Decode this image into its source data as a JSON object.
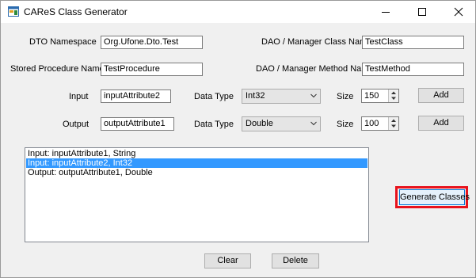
{
  "window": {
    "title": "CAReS Class Generator"
  },
  "labels": {
    "dto_namespace": "DTO Namespace",
    "stored_procedure": "Stored Procedure Name",
    "dao_class": "DAO /  Manager Class Name",
    "dao_method": "DAO /  Manager Method Name",
    "input": "Input",
    "output": "Output",
    "data_type": "Data Type",
    "size": "Size"
  },
  "fields": {
    "dto_namespace": "Org.Ufone.Dto.Test",
    "stored_procedure": "TestProcedure",
    "dao_class": "TestClass",
    "dao_method": "TestMethod",
    "input_attr": "inputAttribute2",
    "output_attr": "outputAttribute1",
    "input_type": "Int32",
    "output_type": "Double",
    "input_size": "150",
    "output_size": "100"
  },
  "buttons": {
    "add": "Add",
    "generate": "Generate Classes",
    "clear": "Clear",
    "delete": "Delete"
  },
  "list": {
    "items": [
      "Input: inputAttribute1, String",
      "Input: inputAttribute2, Int32",
      "Output: outputAttribute1, Double"
    ],
    "selected_index": 1
  },
  "colors": {
    "selection": "#3399ff",
    "highlight_border": "#e8131d",
    "focused_button_border": "#0078d7"
  },
  "icons": {
    "app": "app-window-icon",
    "minimize": "minimize-icon",
    "maximize": "maximize-icon",
    "close": "close-icon"
  }
}
